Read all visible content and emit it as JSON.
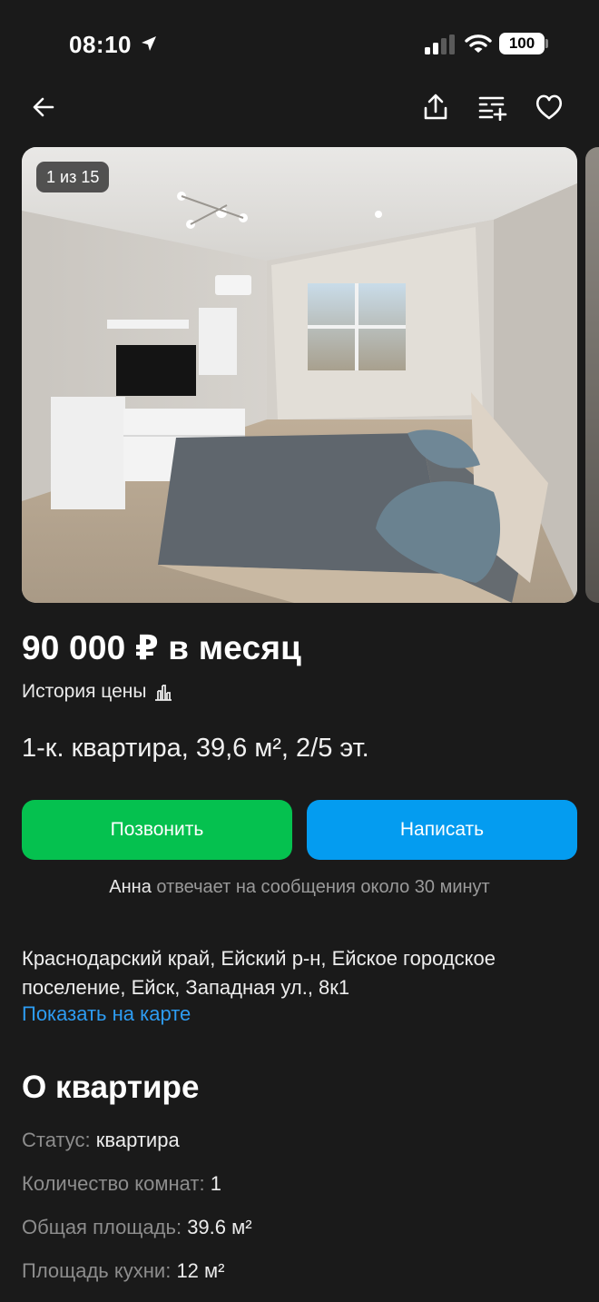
{
  "status_bar": {
    "time": "08:10",
    "battery": "100"
  },
  "gallery": {
    "counter": "1 из 15"
  },
  "listing": {
    "price": "90 000 ₽ в месяц",
    "price_history": "История цены",
    "title": "1-к. квартира, 39,6 м², 2/5 эт."
  },
  "actions": {
    "call": "Позвонить",
    "write": "Написать"
  },
  "seller": {
    "name": "Анна",
    "reply_text": "отвечает на сообщения около 30 минут"
  },
  "location": {
    "address": "Краснодарский край, Ейский р-н, Ейское городское поселение, Ейск, Западная ул., 8к1",
    "map_link": "Показать на карте"
  },
  "about": {
    "title": "О квартире",
    "params": [
      {
        "key": "Статус:",
        "value": "квартира"
      },
      {
        "key": "Количество комнат:",
        "value": "1"
      },
      {
        "key": "Общая площадь:",
        "value": "39.6 м²"
      },
      {
        "key": "Площадь кухни:",
        "value": "12 м²"
      }
    ]
  },
  "colors": {
    "background": "#1a1a1a",
    "call_button": "#05c14f",
    "write_button": "#049cf0",
    "link": "#2d9cf2",
    "muted_text": "#8d8d8d"
  }
}
